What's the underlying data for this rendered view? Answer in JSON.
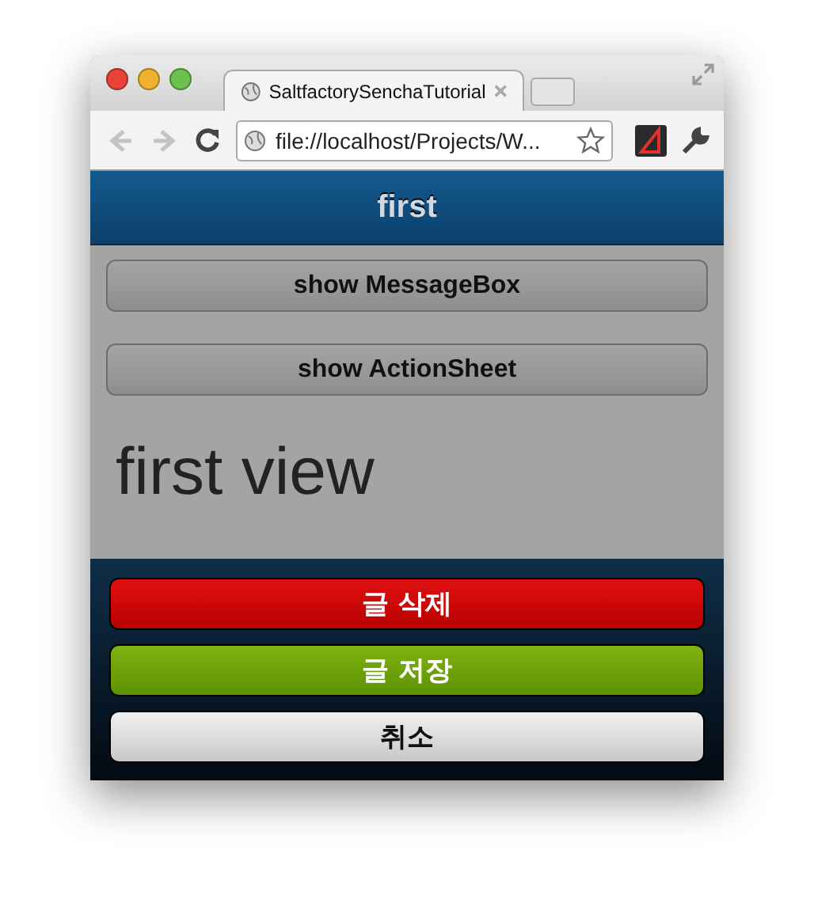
{
  "browser": {
    "tabs": [
      {
        "title": "SaltfactorySenchaTutorial",
        "selected": true
      }
    ],
    "nav": [
      {
        "kind": "back",
        "disabled": true
      },
      {
        "kind": "forward",
        "disabled": true
      },
      {
        "kind": "reload",
        "disabled": false
      }
    ],
    "address": "file://localhost/Projects/W..."
  },
  "titlebar": {
    "title": "first"
  },
  "buttons": [
    "show MessageBox",
    "show ActionSheet"
  ],
  "view_text": "first view",
  "action_sheet": [
    {
      "label": "글 삭제",
      "kind": "decline"
    },
    {
      "label": "글 저장",
      "kind": "confirm"
    },
    {
      "label": "취소",
      "kind": "normal"
    }
  ]
}
